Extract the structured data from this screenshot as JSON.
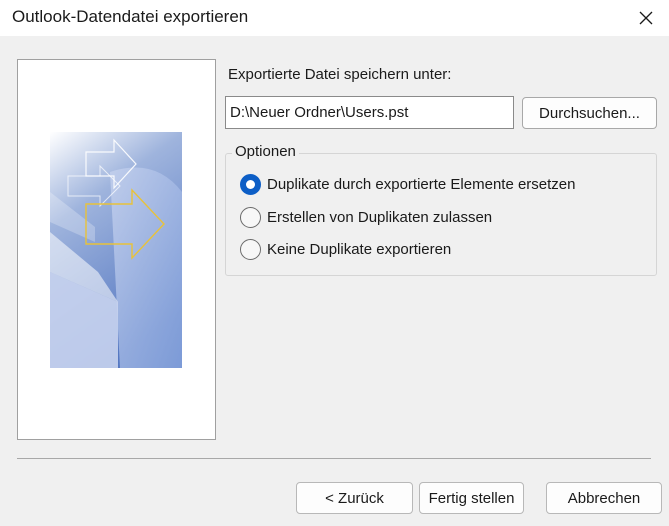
{
  "window": {
    "title": "Outlook-Datendatei exportieren",
    "close_icon": "close-icon"
  },
  "export": {
    "label": "Exportierte Datei speichern unter:",
    "path_value": "D:\\Neuer Ordner\\Users.pst",
    "browse_label": "Durchsuchen..."
  },
  "options": {
    "legend": "Optionen",
    "items": [
      {
        "label": "Duplikate durch exportierte Elemente ersetzen",
        "checked": true
      },
      {
        "label": "Erstellen von Duplikaten zulassen",
        "checked": false
      },
      {
        "label": "Keine Duplikate exportieren",
        "checked": false
      }
    ]
  },
  "footer": {
    "back_label": "< Zurück",
    "finish_label": "Fertig stellen",
    "cancel_label": "Abbrechen"
  },
  "colors": {
    "accent": "#0d5ec6",
    "background": "#f0f0f0",
    "arrow_outline": "#e8c23a"
  }
}
